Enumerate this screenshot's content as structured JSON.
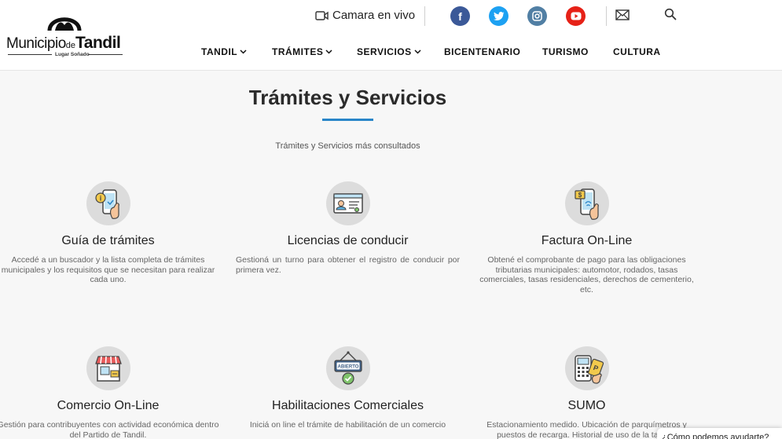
{
  "header": {
    "logo": {
      "name_left": "Municipio",
      "name_mid": "de",
      "name_right": "Tandil",
      "tagline": "Lugar Soñado"
    },
    "camera_label": "Camara en vivo",
    "social": [
      {
        "name": "facebook",
        "glyph": "f",
        "color": "#3b5998"
      },
      {
        "name": "twitter",
        "glyph": "t",
        "color": "#1da1f2"
      },
      {
        "name": "instagram",
        "glyph": "i",
        "color": "#517fa4"
      },
      {
        "name": "youtube",
        "glyph": "y",
        "color": "#e62117"
      }
    ],
    "icons": {
      "mail": "mail-icon",
      "search": "search-icon",
      "camera": "video-camera-icon"
    },
    "nav": [
      {
        "label": "TANDIL",
        "dropdown": true
      },
      {
        "label": "TRÁMITES",
        "dropdown": true
      },
      {
        "label": "SERVICIOS",
        "dropdown": true
      },
      {
        "label": "BICENTENARIO",
        "dropdown": false
      },
      {
        "label": "TURISMO",
        "dropdown": false
      },
      {
        "label": "CULTURA",
        "dropdown": false
      }
    ]
  },
  "main": {
    "title": "Trámites y Servicios",
    "subtitle": "Trámites y Servicios más consultados",
    "accent": "#2a86c9",
    "cards": [
      {
        "icon": "phone-info-icon",
        "title": "Guía de trámites",
        "desc": "Accedé a un buscador y la lista completa de trámites municipales y los requisitos que se necesitan para realizar cada uno."
      },
      {
        "icon": "license-card-icon",
        "title": "Licencias de conducir",
        "desc": "Gestioná un turno para obtener el registro de conducir por primera vez."
      },
      {
        "icon": "phone-bill-icon",
        "title": "Factura On-Line",
        "desc": "Obtené el comprobante de pago para las obligaciones tributarias municipales: automotor, rodados, tasas comerciales, tasas residenciales, derechos de  cementerio, etc."
      },
      {
        "icon": "shop-icon",
        "title": "Comercio On-Line",
        "desc": "Gestión para contribuyentes con actividad económica dentro del Partido de Tandil."
      },
      {
        "icon": "open-sign-icon",
        "title": "Habilitaciones Comerciales",
        "desc": "Iniciá on line el trámite de habilitación de un comercio"
      },
      {
        "icon": "parking-meter-icon",
        "title": "SUMO",
        "desc": "Estacionamiento medido. Ubicación de parquímetros y puestos de recarga. Historial de uso de la tarjeta."
      }
    ],
    "open_sign_text": "ABIERTO",
    "info_glyph": "i",
    "bill_glyph": "$",
    "ticket_glyph": "P"
  },
  "chat": {
    "label": "¿Cómo podemos ayudarte?"
  }
}
